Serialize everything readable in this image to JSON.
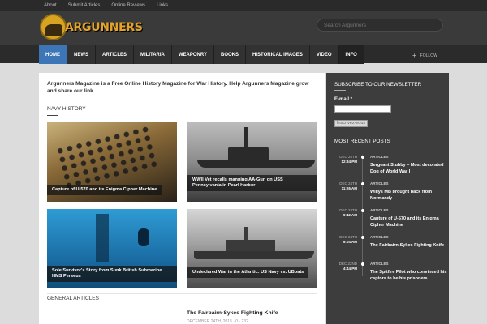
{
  "topbar": {
    "links": [
      "About",
      "Submit Articles",
      "Online Reviews",
      "Links"
    ]
  },
  "header": {
    "logo_text": "ARGUNNERS",
    "search_placeholder": "Search Argunners"
  },
  "nav": {
    "items": [
      "HOME",
      "NEWS",
      "ARTICLES",
      "MILITARIA",
      "WEAPONRY",
      "BOOKS",
      "HISTORICAL IMAGES",
      "VIDEO",
      "INFO"
    ],
    "follow_label": "FOLLOW"
  },
  "main": {
    "intro": "Argunners Magazine is a Free Online History Magazine for War History. Help Argunners Magazine grow and share our link.",
    "navy_title": "NAVY HISTORY",
    "cards": [
      "Capture of U-570 and its Enigma Cipher Machine",
      "WWII Vet recalls manning AA-Gun on USS Pennsylvania in Pearl Harbor",
      "Sole Survivor's Story from Sunk British Submarine HMS Perseus",
      "Undeclared War in the Atlantic: US Navy vs. UBoats"
    ],
    "general_title": "GENERAL ARTICLES",
    "article": {
      "title": "The Fairbairn-Sykes Fighting Knife",
      "meta": "DECEMBER 24TH, 2015  ·  0  ·  232"
    }
  },
  "sidebar": {
    "newsletter_title": "SUBSCRIBE TO OUR NEWSLETTER",
    "email_label": "E-mail *",
    "submit_label": "Inscrivez-vous",
    "recent_title": "MOST RECENT POSTS",
    "posts": [
      {
        "date": "DEC 25TH",
        "time": "12:34 PM",
        "category": "ARTICLES",
        "title": "Sergeant Stubby – Most decorated Dog of World War I"
      },
      {
        "date": "DEC 24TH",
        "time": "11:26 AM",
        "category": "ARTICLES",
        "title": "Willys MB brought back from Normandy"
      },
      {
        "date": "DEC 24TH",
        "time": "9:42 AM",
        "category": "ARTICLES",
        "title": "Capture of U-570 and its Enigma Cipher Machine"
      },
      {
        "date": "DEC 24TH",
        "time": "9:04 AM",
        "category": "ARTICLES",
        "title": "The Fairbairn-Sykes Fighting Knife"
      },
      {
        "date": "DEC 22ND",
        "time": "4:44 PM",
        "category": "ARTICLES",
        "title": "The Spitfire Pilot who convinced his captors to be his prisoners"
      }
    ]
  },
  "colors": {
    "accent": "#3c76b6",
    "logo": "#e3a32a",
    "sidebar_bg": "#3d3d3d",
    "header_bg": "#3a3a3a"
  }
}
